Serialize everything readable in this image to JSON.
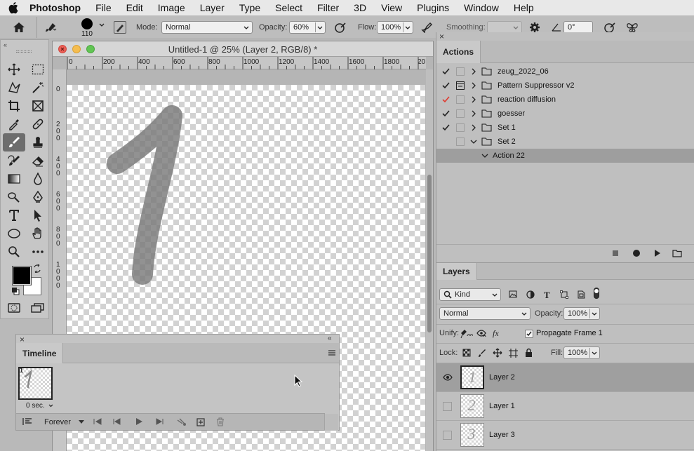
{
  "menubar": {
    "app_name": "Photoshop",
    "items": [
      "File",
      "Edit",
      "Image",
      "Layer",
      "Type",
      "Select",
      "Filter",
      "3D",
      "View",
      "Plugins",
      "Window",
      "Help"
    ]
  },
  "options": {
    "brush_size": "110",
    "mode_label": "Mode:",
    "mode_value": "Normal",
    "opacity_label": "Opacity:",
    "opacity_value": "60%",
    "flow_label": "Flow:",
    "flow_value": "100%",
    "smoothing_label": "Smoothing:",
    "smoothing_value": "",
    "angle_value": "0°"
  },
  "document": {
    "title": "Untitled-1 @ 25% (Layer 2, RGB/8) *",
    "ruler_top": [
      "0",
      "200",
      "400",
      "600",
      "800",
      "1000",
      "1200",
      "1400",
      "1600",
      "1800",
      "20"
    ],
    "ruler_left": [
      "0",
      "2 0 0",
      "4 0 0",
      "6 0 0",
      "8 0 0",
      "1 0 0 0"
    ]
  },
  "colors": {
    "foreground": "#000000",
    "background": "#ffffff",
    "stroke": "#7a7a7a",
    "record_check": "#e03a2f"
  },
  "timeline": {
    "title": "Timeline",
    "frame_number": "1",
    "frame_delay": "0 sec.",
    "loop_value": "Forever"
  },
  "actions": {
    "title": "Actions",
    "rows": [
      {
        "name": "zeug_2022_06",
        "checked": true,
        "red": false,
        "expanded": false
      },
      {
        "name": "Pattern Suppressor v2",
        "checked": true,
        "red": false,
        "expanded": false
      },
      {
        "name": "reaction diffusion",
        "checked": true,
        "red": true,
        "expanded": false
      },
      {
        "name": "goesser",
        "checked": true,
        "red": false,
        "expanded": false
      },
      {
        "name": "Set 1",
        "checked": true,
        "red": false,
        "expanded": false
      },
      {
        "name": "Set 2",
        "checked": false,
        "red": false,
        "expanded": true
      }
    ],
    "sub_action": "Action 22"
  },
  "layers": {
    "title": "Layers",
    "kind_label": "Kind",
    "blend_mode": "Normal",
    "opacity_label": "Opacity:",
    "opacity_value": "100%",
    "unify_label": "Unify:",
    "propagate_label": "Propagate Frame 1",
    "lock_label": "Lock:",
    "fill_label": "Fill:",
    "fill_value": "100%",
    "items": [
      {
        "name": "Layer 2",
        "glyph": "1",
        "selected": true,
        "visible": true
      },
      {
        "name": "Layer 1",
        "glyph": "2",
        "selected": false,
        "visible": false
      },
      {
        "name": "Layer 3",
        "glyph": "3",
        "selected": false,
        "visible": false
      }
    ]
  }
}
